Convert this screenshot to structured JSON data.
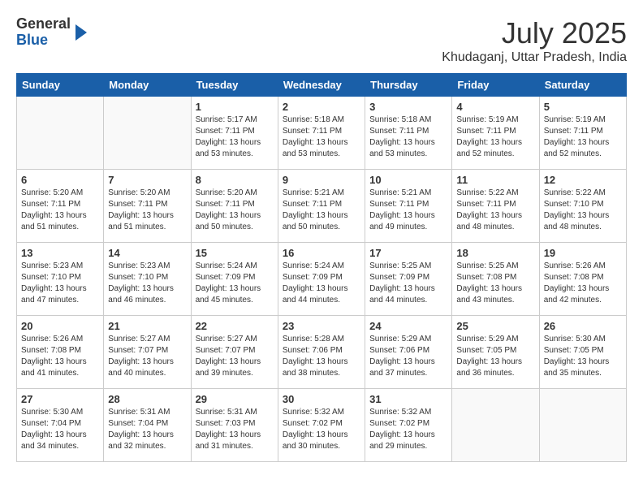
{
  "logo": {
    "general": "General",
    "blue": "Blue"
  },
  "title": {
    "month_year": "July 2025",
    "location": "Khudaganj, Uttar Pradesh, India"
  },
  "weekdays": [
    "Sunday",
    "Monday",
    "Tuesday",
    "Wednesday",
    "Thursday",
    "Friday",
    "Saturday"
  ],
  "weeks": [
    [
      {
        "day": "",
        "empty": true
      },
      {
        "day": "",
        "empty": true
      },
      {
        "day": "1",
        "sunrise": "Sunrise: 5:17 AM",
        "sunset": "Sunset: 7:11 PM",
        "daylight": "Daylight: 13 hours and 53 minutes."
      },
      {
        "day": "2",
        "sunrise": "Sunrise: 5:18 AM",
        "sunset": "Sunset: 7:11 PM",
        "daylight": "Daylight: 13 hours and 53 minutes."
      },
      {
        "day": "3",
        "sunrise": "Sunrise: 5:18 AM",
        "sunset": "Sunset: 7:11 PM",
        "daylight": "Daylight: 13 hours and 53 minutes."
      },
      {
        "day": "4",
        "sunrise": "Sunrise: 5:19 AM",
        "sunset": "Sunset: 7:11 PM",
        "daylight": "Daylight: 13 hours and 52 minutes."
      },
      {
        "day": "5",
        "sunrise": "Sunrise: 5:19 AM",
        "sunset": "Sunset: 7:11 PM",
        "daylight": "Daylight: 13 hours and 52 minutes."
      }
    ],
    [
      {
        "day": "6",
        "sunrise": "Sunrise: 5:20 AM",
        "sunset": "Sunset: 7:11 PM",
        "daylight": "Daylight: 13 hours and 51 minutes."
      },
      {
        "day": "7",
        "sunrise": "Sunrise: 5:20 AM",
        "sunset": "Sunset: 7:11 PM",
        "daylight": "Daylight: 13 hours and 51 minutes."
      },
      {
        "day": "8",
        "sunrise": "Sunrise: 5:20 AM",
        "sunset": "Sunset: 7:11 PM",
        "daylight": "Daylight: 13 hours and 50 minutes."
      },
      {
        "day": "9",
        "sunrise": "Sunrise: 5:21 AM",
        "sunset": "Sunset: 7:11 PM",
        "daylight": "Daylight: 13 hours and 50 minutes."
      },
      {
        "day": "10",
        "sunrise": "Sunrise: 5:21 AM",
        "sunset": "Sunset: 7:11 PM",
        "daylight": "Daylight: 13 hours and 49 minutes."
      },
      {
        "day": "11",
        "sunrise": "Sunrise: 5:22 AM",
        "sunset": "Sunset: 7:11 PM",
        "daylight": "Daylight: 13 hours and 48 minutes."
      },
      {
        "day": "12",
        "sunrise": "Sunrise: 5:22 AM",
        "sunset": "Sunset: 7:10 PM",
        "daylight": "Daylight: 13 hours and 48 minutes."
      }
    ],
    [
      {
        "day": "13",
        "sunrise": "Sunrise: 5:23 AM",
        "sunset": "Sunset: 7:10 PM",
        "daylight": "Daylight: 13 hours and 47 minutes."
      },
      {
        "day": "14",
        "sunrise": "Sunrise: 5:23 AM",
        "sunset": "Sunset: 7:10 PM",
        "daylight": "Daylight: 13 hours and 46 minutes."
      },
      {
        "day": "15",
        "sunrise": "Sunrise: 5:24 AM",
        "sunset": "Sunset: 7:09 PM",
        "daylight": "Daylight: 13 hours and 45 minutes."
      },
      {
        "day": "16",
        "sunrise": "Sunrise: 5:24 AM",
        "sunset": "Sunset: 7:09 PM",
        "daylight": "Daylight: 13 hours and 44 minutes."
      },
      {
        "day": "17",
        "sunrise": "Sunrise: 5:25 AM",
        "sunset": "Sunset: 7:09 PM",
        "daylight": "Daylight: 13 hours and 44 minutes."
      },
      {
        "day": "18",
        "sunrise": "Sunrise: 5:25 AM",
        "sunset": "Sunset: 7:08 PM",
        "daylight": "Daylight: 13 hours and 43 minutes."
      },
      {
        "day": "19",
        "sunrise": "Sunrise: 5:26 AM",
        "sunset": "Sunset: 7:08 PM",
        "daylight": "Daylight: 13 hours and 42 minutes."
      }
    ],
    [
      {
        "day": "20",
        "sunrise": "Sunrise: 5:26 AM",
        "sunset": "Sunset: 7:08 PM",
        "daylight": "Daylight: 13 hours and 41 minutes."
      },
      {
        "day": "21",
        "sunrise": "Sunrise: 5:27 AM",
        "sunset": "Sunset: 7:07 PM",
        "daylight": "Daylight: 13 hours and 40 minutes."
      },
      {
        "day": "22",
        "sunrise": "Sunrise: 5:27 AM",
        "sunset": "Sunset: 7:07 PM",
        "daylight": "Daylight: 13 hours and 39 minutes."
      },
      {
        "day": "23",
        "sunrise": "Sunrise: 5:28 AM",
        "sunset": "Sunset: 7:06 PM",
        "daylight": "Daylight: 13 hours and 38 minutes."
      },
      {
        "day": "24",
        "sunrise": "Sunrise: 5:29 AM",
        "sunset": "Sunset: 7:06 PM",
        "daylight": "Daylight: 13 hours and 37 minutes."
      },
      {
        "day": "25",
        "sunrise": "Sunrise: 5:29 AM",
        "sunset": "Sunset: 7:05 PM",
        "daylight": "Daylight: 13 hours and 36 minutes."
      },
      {
        "day": "26",
        "sunrise": "Sunrise: 5:30 AM",
        "sunset": "Sunset: 7:05 PM",
        "daylight": "Daylight: 13 hours and 35 minutes."
      }
    ],
    [
      {
        "day": "27",
        "sunrise": "Sunrise: 5:30 AM",
        "sunset": "Sunset: 7:04 PM",
        "daylight": "Daylight: 13 hours and 34 minutes."
      },
      {
        "day": "28",
        "sunrise": "Sunrise: 5:31 AM",
        "sunset": "Sunset: 7:04 PM",
        "daylight": "Daylight: 13 hours and 32 minutes."
      },
      {
        "day": "29",
        "sunrise": "Sunrise: 5:31 AM",
        "sunset": "Sunset: 7:03 PM",
        "daylight": "Daylight: 13 hours and 31 minutes."
      },
      {
        "day": "30",
        "sunrise": "Sunrise: 5:32 AM",
        "sunset": "Sunset: 7:02 PM",
        "daylight": "Daylight: 13 hours and 30 minutes."
      },
      {
        "day": "31",
        "sunrise": "Sunrise: 5:32 AM",
        "sunset": "Sunset: 7:02 PM",
        "daylight": "Daylight: 13 hours and 29 minutes."
      },
      {
        "day": "",
        "empty": true
      },
      {
        "day": "",
        "empty": true
      }
    ]
  ]
}
